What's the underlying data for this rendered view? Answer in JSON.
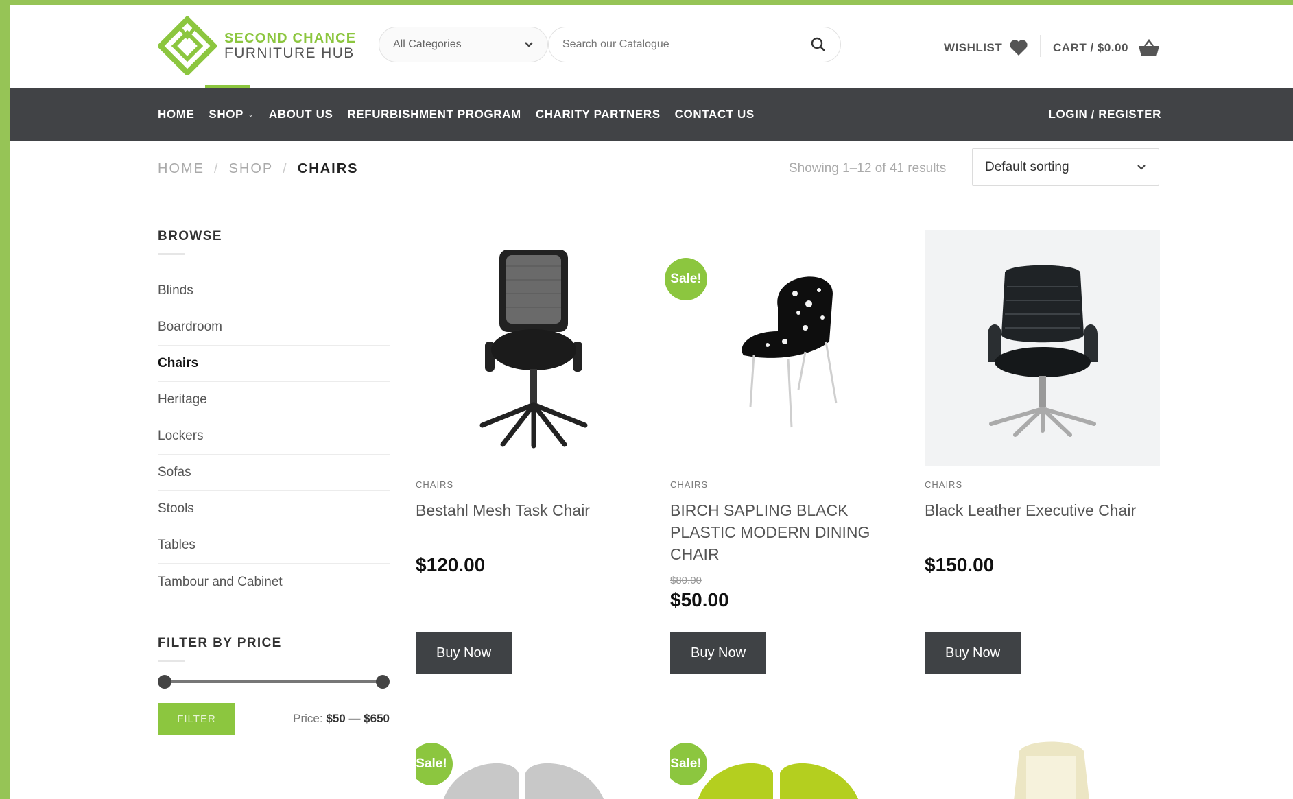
{
  "brand": {
    "line1": "SECOND CHANCE",
    "line2": "FURNITURE HUB",
    "accent": "#8cc63f"
  },
  "header": {
    "category_select": "All Categories",
    "search_placeholder": "Search our Catalogue",
    "wishlist_label": "WISHLIST",
    "cart_label": "CART / $0.00"
  },
  "nav": {
    "items": [
      "HOME",
      "SHOP",
      "ABOUT US",
      "REFURBISHMENT PROGRAM",
      "CHARITY PARTNERS",
      "CONTACT US"
    ],
    "login": "LOGIN / REGISTER"
  },
  "breadcrumb": {
    "home": "HOME",
    "shop": "SHOP",
    "current": "CHAIRS",
    "sep": "/"
  },
  "results_text": "Showing 1–12 of 41 results",
  "sort_label": "Default sorting",
  "sidebar": {
    "browse_title": "BROWSE",
    "categories": [
      "Blinds",
      "Boardroom",
      "Chairs",
      "Heritage",
      "Lockers",
      "Sofas",
      "Stools",
      "Tables",
      "Tambour and Cabinet"
    ],
    "active_category": "Chairs",
    "price_title": "FILTER BY PRICE",
    "filter_button": "FILTER",
    "price_label": "Price:",
    "price_range": "$50 — $650",
    "price_min": 50,
    "price_max": 650
  },
  "products": [
    {
      "category": "CHAIRS",
      "name": "Bestahl Mesh Task Chair",
      "price": "$120.00",
      "button": "Buy Now"
    },
    {
      "category": "CHAIRS",
      "name": "BIRCH SAPLING BLACK PLASTIC MODERN DINING CHAIR",
      "old_price": "$80.00",
      "price": "$50.00",
      "sale": "Sale!",
      "button": "Buy Now"
    },
    {
      "category": "CHAIRS",
      "name": "Black Leather Executive Chair",
      "price": "$150.00",
      "button": "Buy Now"
    }
  ],
  "row2": {
    "sale_badge": "Sale!"
  }
}
